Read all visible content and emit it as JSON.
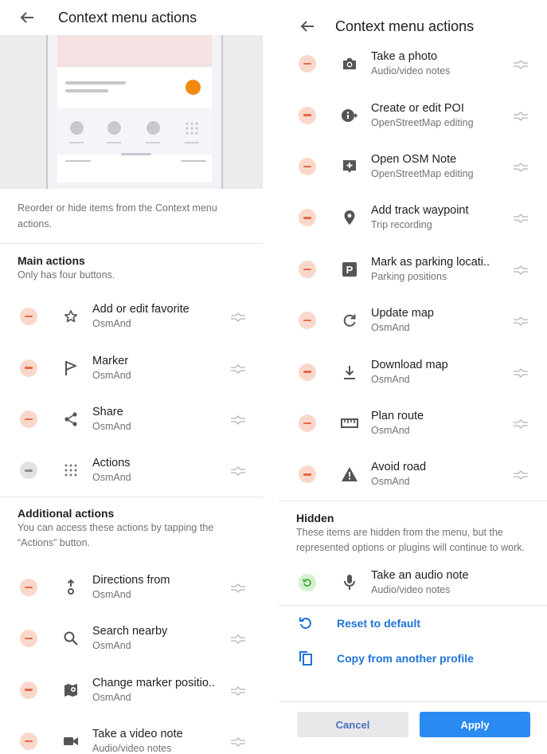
{
  "left": {
    "header": {
      "title": "Context menu actions"
    },
    "description": "Reorder or hide items from the Context menu actions.",
    "main": {
      "title": "Main actions",
      "subtitle": "Only has four buttons.",
      "items": [
        {
          "icon": "star-icon",
          "title": "Add or edit favorite",
          "subtitle": "OsmAnd"
        },
        {
          "icon": "flag-icon",
          "title": "Marker",
          "subtitle": "OsmAnd"
        },
        {
          "icon": "share-icon",
          "title": "Share",
          "subtitle": "OsmAnd"
        },
        {
          "icon": "dots-grid-icon",
          "title": "Actions",
          "subtitle": "OsmAnd"
        }
      ]
    },
    "additional": {
      "title": "Additional actions",
      "subtitle": "You can access these actions by tapping the “Actions” button.",
      "items": [
        {
          "icon": "directions-from-icon",
          "title": "Directions from",
          "subtitle": "OsmAnd"
        },
        {
          "icon": "search-icon",
          "title": "Search nearby",
          "subtitle": "OsmAnd"
        },
        {
          "icon": "map-marker-move-icon",
          "title": "Change marker positio..",
          "subtitle": "OsmAnd"
        },
        {
          "icon": "video-camera-icon",
          "title": "Take a video note",
          "subtitle": "Audio/video notes"
        }
      ]
    }
  },
  "right": {
    "header": {
      "title": "Context menu actions"
    },
    "items": [
      {
        "icon": "camera-icon",
        "title": "Take a photo",
        "subtitle": "Audio/video notes"
      },
      {
        "icon": "poi-edit-icon",
        "title": "Create or edit POI",
        "subtitle": "OpenStreetMap editing"
      },
      {
        "icon": "osm-note-icon",
        "title": "Open OSM Note",
        "subtitle": "OpenStreetMap editing"
      },
      {
        "icon": "map-pin-icon",
        "title": "Add track waypoint",
        "subtitle": "Trip recording"
      },
      {
        "icon": "parking-icon",
        "title": "Mark as parking locati..",
        "subtitle": "Parking positions"
      },
      {
        "icon": "refresh-icon",
        "title": "Update map",
        "subtitle": "OsmAnd"
      },
      {
        "icon": "download-icon",
        "title": "Download map",
        "subtitle": "OsmAnd"
      },
      {
        "icon": "ruler-icon",
        "title": "Plan route",
        "subtitle": "OsmAnd"
      },
      {
        "icon": "warning-icon",
        "title": "Avoid road",
        "subtitle": "OsmAnd"
      }
    ],
    "hidden": {
      "title": "Hidden",
      "subtitle": "These items are hidden from the menu, but the represented options or plugins will continue to work.",
      "items": [
        {
          "icon": "microphone-icon",
          "title": "Take an audio note",
          "subtitle": "Audio/video notes"
        }
      ]
    },
    "links": {
      "reset": "Reset to default",
      "copy": "Copy from another profile"
    },
    "buttons": {
      "cancel": "Cancel",
      "apply": "Apply"
    }
  },
  "colors": {
    "accent": "#2b8af1",
    "link": "#2174d6",
    "remove": "#e8694a",
    "remove_bg": "#f9d8cb",
    "restore_bg": "#d4f0cf",
    "marker_dot": "#f28a0f"
  }
}
